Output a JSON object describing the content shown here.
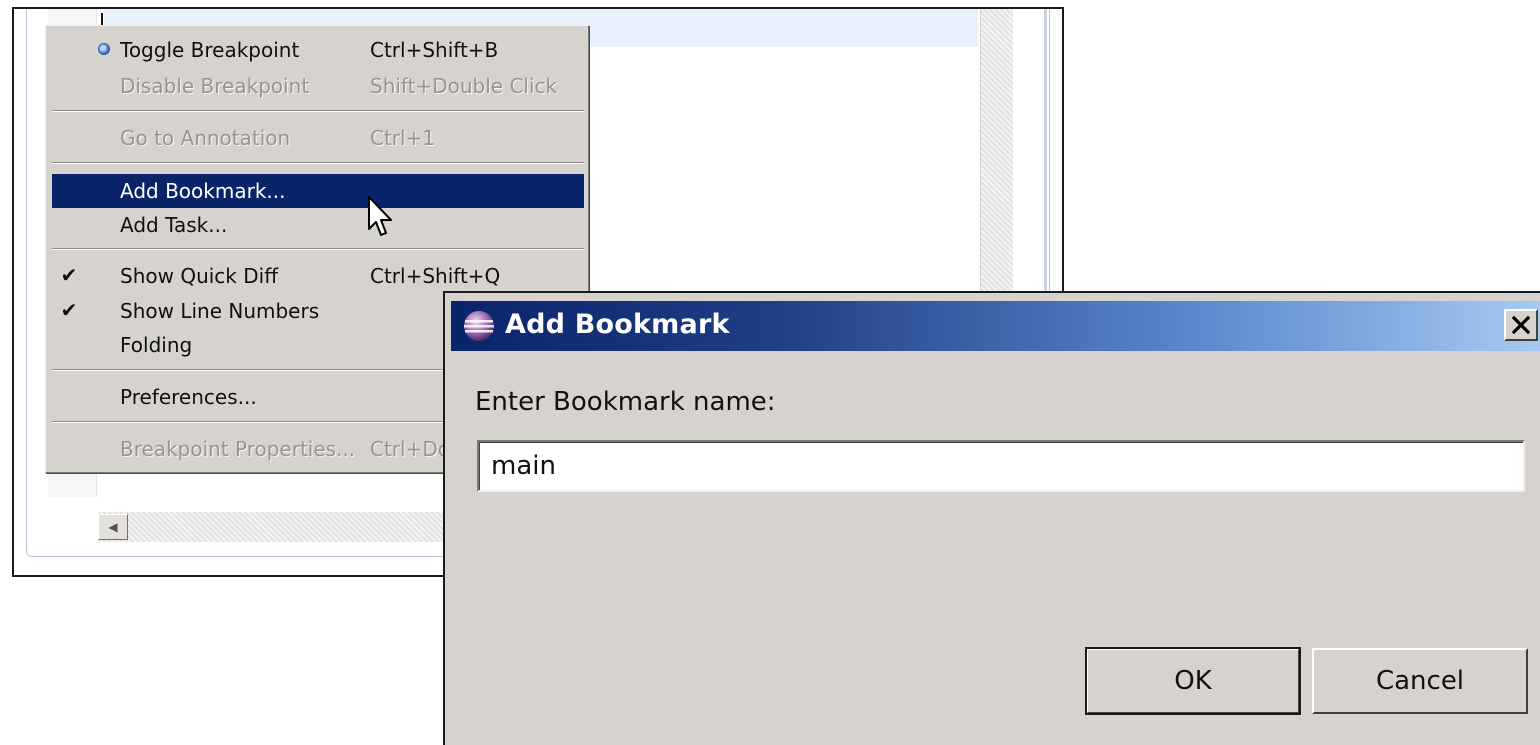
{
  "context_menu": {
    "items": [
      {
        "label": "Toggle Breakpoint",
        "shortcut": "Ctrl+Shift+B",
        "disabled": false,
        "mark": "radio"
      },
      {
        "label": "Disable Breakpoint",
        "shortcut": "Shift+Double Click",
        "disabled": true
      },
      {
        "label": "Go to Annotation",
        "shortcut": "Ctrl+1",
        "disabled": true
      },
      {
        "label": "Add Bookmark...",
        "shortcut": "",
        "disabled": false,
        "highlighted": true
      },
      {
        "label": "Add Task...",
        "shortcut": "",
        "disabled": false
      },
      {
        "label": "Show Quick Diff",
        "shortcut": "Ctrl+Shift+Q",
        "disabled": false,
        "mark": "check"
      },
      {
        "label": "Show Line Numbers",
        "shortcut": "",
        "disabled": false,
        "mark": "check"
      },
      {
        "label": "Folding",
        "shortcut": "",
        "disabled": false
      },
      {
        "label": "Preferences...",
        "shortcut": "",
        "disabled": false
      },
      {
        "label": "Breakpoint Properties...",
        "shortcut": "Ctrl+Do",
        "disabled": true
      }
    ],
    "check_glyph": "✔"
  },
  "dialog": {
    "title": "Add Bookmark",
    "close_glyph": "✕",
    "prompt": "Enter Bookmark name:",
    "input_value": "main",
    "ok_label": "OK",
    "cancel_label": "Cancel"
  },
  "editor": {
    "scroll_left_glyph": "◀"
  },
  "colors": {
    "menu_highlight": "#0a246a",
    "titlebar_start": "#0a246a",
    "titlebar_end": "#a6caf0",
    "dialog_face": "#d6d3ce"
  }
}
